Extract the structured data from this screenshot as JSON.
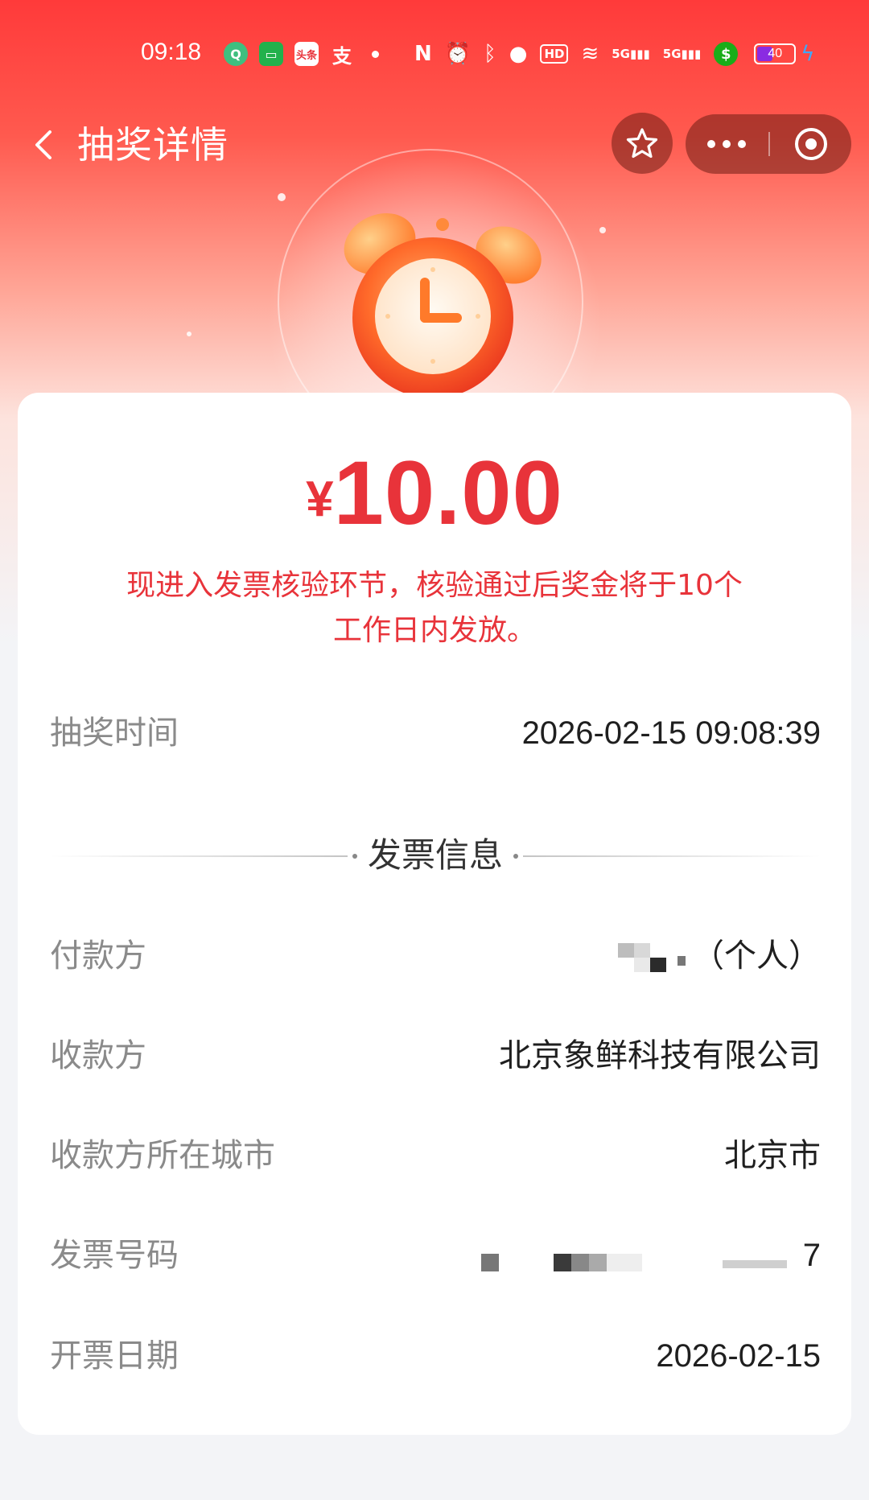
{
  "status_bar": {
    "time": "09:18",
    "battery_level": "40",
    "network_label_1": "5G",
    "network_label_2": "5G",
    "hd_label": "HD"
  },
  "header": {
    "title": "抽奖详情",
    "icons": [
      "back-icon",
      "star-icon",
      "more-icon",
      "close-target-icon"
    ]
  },
  "prize": {
    "currency": "¥",
    "amount": "10.00",
    "notice": "现进入发票核验环节，核验通过后奖金将于10个工作日内发放。"
  },
  "draw": {
    "time_label": "抽奖时间",
    "time_value": "2026-02-15 09:08:39"
  },
  "invoice": {
    "section_title": "发票信息",
    "payer_label": "付款方",
    "payer_suffix": "（个人）",
    "payee_label": "收款方",
    "payee_value": "北京象鲜科技有限公司",
    "city_label": "收款方所在城市",
    "city_value": "北京市",
    "number_label": "发票号码",
    "number_visible_suffix": "7",
    "date_label": "开票日期",
    "date_value": "2026-02-15"
  },
  "colors": {
    "accent": "#e8333a",
    "header_red": "#ff3a3a",
    "label_gray": "#8a8a8a",
    "value_dark": "#1f1f1f"
  }
}
